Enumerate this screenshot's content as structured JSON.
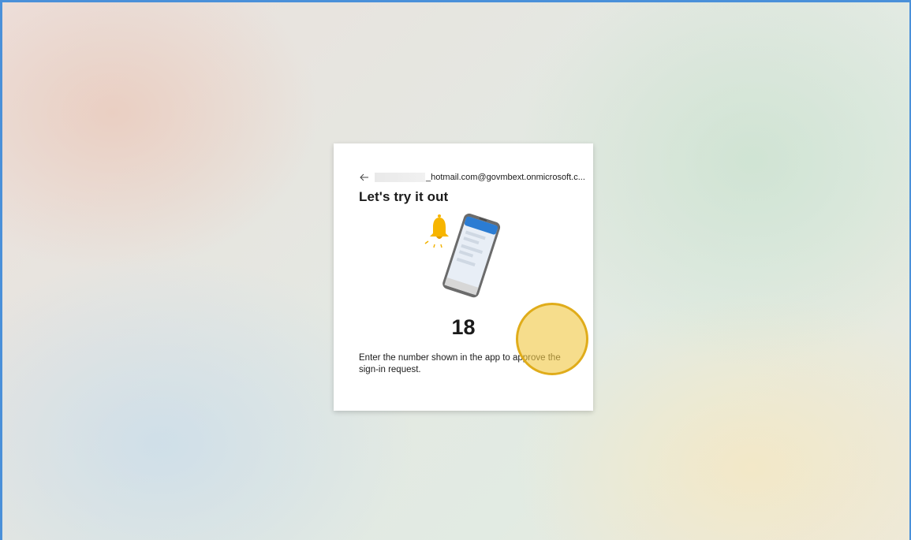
{
  "signin": {
    "back_label": "Back",
    "account_suffix": "_hotmail.com@govmbext.onmicrosoft.c...",
    "title": "Let's try it out",
    "number": "18",
    "instruction": "Enter the number shown in the app to approve the sign-in request."
  },
  "icons": {
    "back": "back-arrow-icon",
    "illustration": "bell-and-phone-illustration"
  },
  "colors": {
    "accent_blue": "#4a90d9",
    "phone_screen_header": "#2b7cd3",
    "bell": "#f7b500",
    "cursor_highlight": "#e0ac1a"
  }
}
